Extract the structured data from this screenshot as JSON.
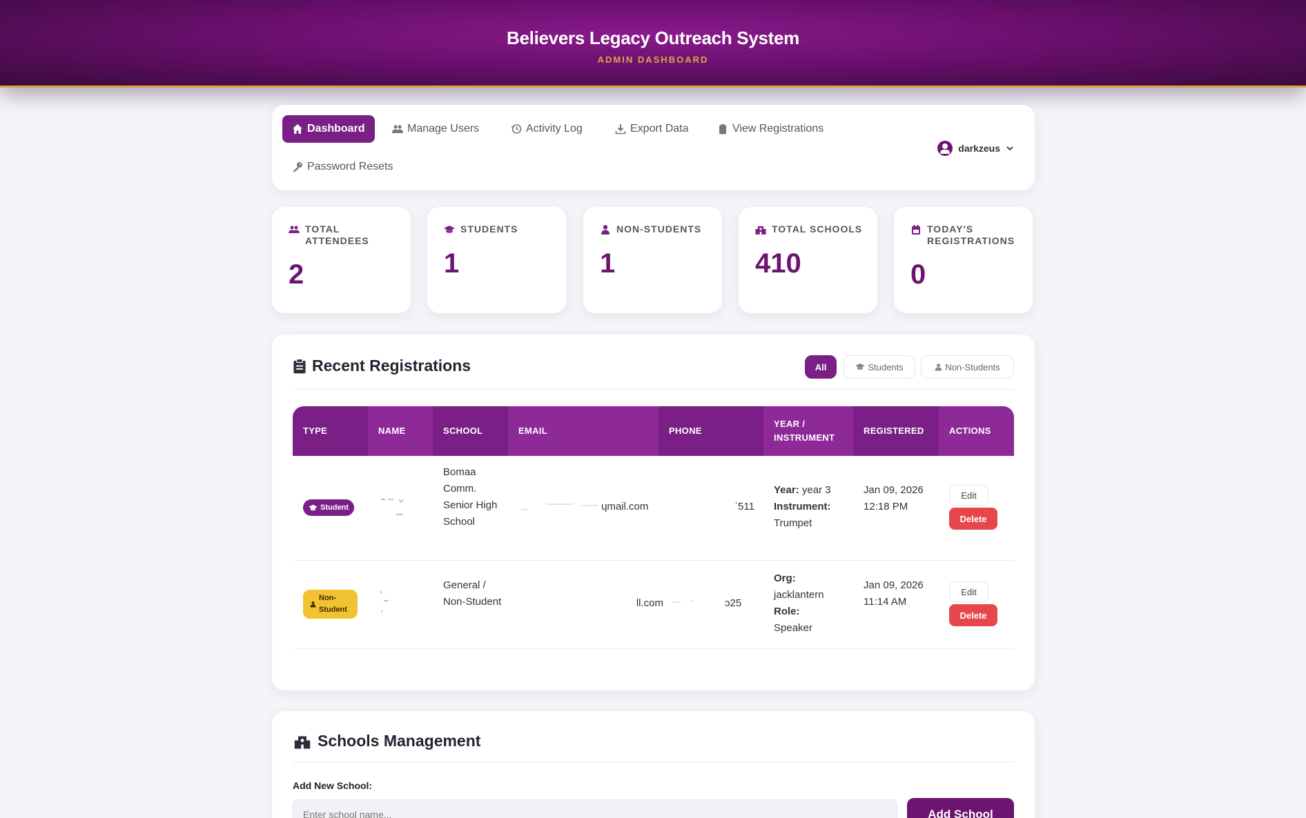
{
  "header": {
    "title": "Believers Legacy Outreach System",
    "subtitle": "ADMIN DASHBOARD"
  },
  "nav": {
    "items": [
      {
        "label": "Dashboard",
        "icon": "home-icon",
        "active": true
      },
      {
        "label": "Manage Users",
        "icon": "users-icon"
      },
      {
        "label": "Activity Log",
        "icon": "history-icon"
      },
      {
        "label": "Export Data",
        "icon": "download-icon"
      },
      {
        "label": "View Registrations",
        "icon": "clipboard-icon"
      },
      {
        "label": "Password Resets",
        "icon": "key-icon"
      }
    ],
    "user": "darkzeus"
  },
  "stats": [
    {
      "label": "TOTAL ATTENDEES",
      "value": "2",
      "icon": "users-icon"
    },
    {
      "label": "STUDENTS",
      "value": "1",
      "icon": "graduation-cap-icon"
    },
    {
      "label": "NON-STUDENTS",
      "value": "1",
      "icon": "user-icon"
    },
    {
      "label": "TOTAL SCHOOLS",
      "value": "410",
      "icon": "school-icon"
    },
    {
      "label": "TODAY'S REGISTRATIONS",
      "value": "0",
      "icon": "calendar-icon"
    }
  ],
  "registrations": {
    "title": "Recent Registrations",
    "filters": [
      "All",
      "Students",
      "Non-Students"
    ],
    "columns": [
      "TYPE",
      "NAME",
      "SCHOOL",
      "EMAIL",
      "PHONE",
      "YEAR / INSTRUMENT",
      "REGISTERED",
      "ACTIONS"
    ],
    "rows": [
      {
        "type": "Student",
        "school": "Bomaa Comm. Senior High School",
        "email_fragment": "ɥmail.com",
        "phone_fragment": "ˈ511",
        "detail1_key": "Year:",
        "detail1_val": "year 3",
        "detail2_key": "Instrument:",
        "detail2_val": "Trumpet",
        "registered": "Jan 09, 2026 12:18 PM"
      },
      {
        "type": "Non-Student",
        "school": "General / Non-Student",
        "email_fragment": "ll.com",
        "phone_fragment": "ͻ25",
        "detail1_key": "Org:",
        "detail1_val": "jacklantern",
        "detail2_key": "Role:",
        "detail2_val": "Speaker",
        "registered": "Jan 09, 2026 11:14 AM"
      }
    ],
    "edit_label": "Edit",
    "delete_label": "Delete"
  },
  "schools": {
    "title": "Schools Management",
    "add_label": "Add New School:",
    "placeholder": "Enter school name...",
    "add_button": "Add School"
  },
  "colors": {
    "brand": "#7a1f86",
    "accent": "#e0a640",
    "danger": "#e7474b",
    "nonstudent": "#f1c232"
  }
}
